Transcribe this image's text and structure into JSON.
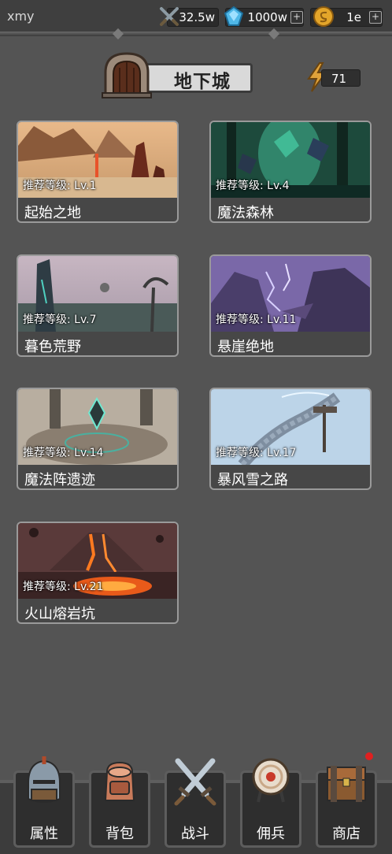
{
  "header": {
    "username": "xmy",
    "resources": [
      {
        "name": "power",
        "icon": "crossed-swords-icon",
        "value": "32.5w",
        "has_plus": false
      },
      {
        "name": "gems",
        "icon": "blue-gem-icon",
        "value": "1000w",
        "has_plus": true
      },
      {
        "name": "coins",
        "icon": "gold-coin-icon",
        "value": "1e",
        "has_plus": true
      }
    ],
    "plus_label": "+"
  },
  "page": {
    "title": "地下城",
    "energy": "71"
  },
  "dungeons": [
    {
      "name": "起始之地",
      "level": "推荐等级: Lv.1",
      "theme": "desert"
    },
    {
      "name": "魔法森林",
      "level": "推荐等级: Lv.4",
      "theme": "forest"
    },
    {
      "name": "暮色荒野",
      "level": "推荐等级: Lv.7",
      "theme": "wilds"
    },
    {
      "name": "悬崖绝地",
      "level": "推荐等级: Lv.11",
      "theme": "cliff"
    },
    {
      "name": "魔法阵遗迹",
      "level": "推荐等级: Lv.14",
      "theme": "ruins"
    },
    {
      "name": "暴风雪之路",
      "level": "推荐等级: Lv.17",
      "theme": "snow"
    },
    {
      "name": "火山熔岩坑",
      "level": "推荐等级: Lv.21",
      "theme": "volcano"
    }
  ],
  "nav": [
    {
      "label": "属性",
      "icon": "knight-helmet-icon"
    },
    {
      "label": "背包",
      "icon": "backpack-icon"
    },
    {
      "label": "战斗",
      "icon": "crossed-swords-icon"
    },
    {
      "label": "佣兵",
      "icon": "archery-target-icon"
    },
    {
      "label": "商店",
      "icon": "treasure-chest-icon",
      "notification": true
    }
  ],
  "colors": {
    "background": "#545454",
    "card_border": "#9a9a9a",
    "notification": "#e02020"
  }
}
